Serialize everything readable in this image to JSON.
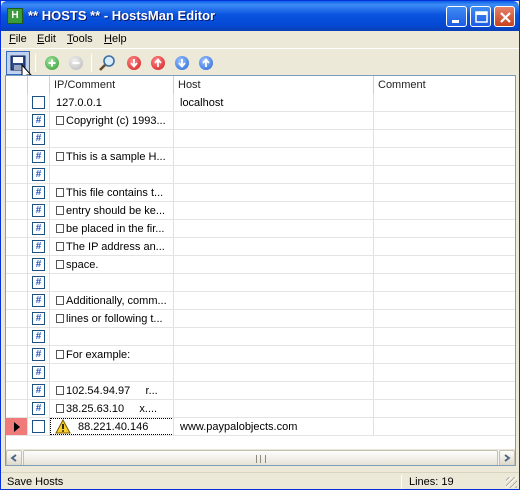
{
  "window": {
    "title": "** HOSTS ** - HostsMan Editor",
    "app_icon_glyph": "H"
  },
  "menu": [
    "File",
    "Edit",
    "Tools",
    "Help"
  ],
  "toolbar": {
    "buttons": [
      {
        "name": "save-hosts",
        "icon": "floppy-disk-icon",
        "tooltip": "Save Hosts"
      },
      {
        "name": "add-entry",
        "icon": "green-plus-circle-icon"
      },
      {
        "name": "remove-entry",
        "icon": "gray-minus-circle-icon"
      },
      {
        "name": "find",
        "icon": "magnifier-icon"
      },
      {
        "name": "move-bottom",
        "icon": "red-down-arrow-icon"
      },
      {
        "name": "move-top",
        "icon": "red-up-arrow-icon"
      },
      {
        "name": "move-down",
        "icon": "blue-down-arrow-icon"
      },
      {
        "name": "move-up",
        "icon": "blue-up-arrow-icon"
      }
    ]
  },
  "grid": {
    "columns": [
      "IP/Comment",
      "Host",
      "Comment"
    ],
    "rows": [
      {
        "type": "entry",
        "ip": "127.0.0.1",
        "host": "localhost",
        "comment": ""
      },
      {
        "type": "comment",
        "ip": "Copyright (c) 1993...",
        "host": "",
        "comment": ""
      },
      {
        "type": "comment",
        "ip": "",
        "host": "",
        "comment": ""
      },
      {
        "type": "comment",
        "ip": "This is a sample H...",
        "host": "",
        "comment": ""
      },
      {
        "type": "comment",
        "ip": "",
        "host": "",
        "comment": ""
      },
      {
        "type": "comment",
        "ip": "This file contains t...",
        "host": "",
        "comment": ""
      },
      {
        "type": "comment",
        "ip": "entry should be ke...",
        "host": "",
        "comment": ""
      },
      {
        "type": "comment",
        "ip": "be placed in the fir...",
        "host": "",
        "comment": ""
      },
      {
        "type": "comment",
        "ip": "The IP address an...",
        "host": "",
        "comment": ""
      },
      {
        "type": "comment",
        "ip": "space.",
        "host": "",
        "comment": ""
      },
      {
        "type": "comment",
        "ip": "",
        "host": "",
        "comment": ""
      },
      {
        "type": "comment",
        "ip": "Additionally, comm...",
        "host": "",
        "comment": ""
      },
      {
        "type": "comment",
        "ip": "lines or following t...",
        "host": "",
        "comment": ""
      },
      {
        "type": "comment",
        "ip": "",
        "host": "",
        "comment": ""
      },
      {
        "type": "comment",
        "ip": "For example:",
        "host": "",
        "comment": ""
      },
      {
        "type": "comment",
        "ip": "",
        "host": "",
        "comment": ""
      },
      {
        "type": "comment",
        "ip": "102.54.94.97     r...",
        "host": "",
        "comment": ""
      },
      {
        "type": "comment",
        "ip": "38.25.63.10     x....",
        "host": "",
        "comment": ""
      },
      {
        "type": "entry-warning",
        "ip": "88.221.40.146",
        "host": "www.paypalobjects.com",
        "comment": "",
        "selected": true
      }
    ]
  },
  "status": {
    "left": "Save Hosts",
    "right": "Lines: 19"
  },
  "colors": {
    "selected_row_marker": "#f07a7a",
    "titlebar": "#0a54e0"
  }
}
